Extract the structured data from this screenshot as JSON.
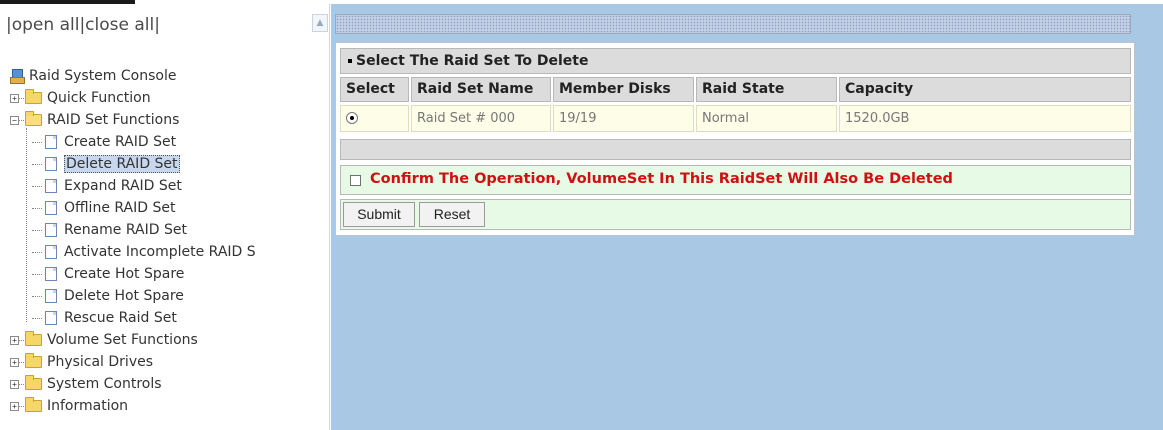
{
  "nav": {
    "open_all": "open all",
    "close_all": "close all",
    "separator_left": "|",
    "separator_mid": "|",
    "separator_right": "|"
  },
  "tree": {
    "root": "Raid System Console",
    "quick_function": "Quick Function",
    "raid_set_functions": "RAID Set Functions",
    "children": [
      "Create RAID Set",
      "Delete RAID Set",
      "Expand RAID Set",
      "Offline RAID Set",
      "Rename RAID Set",
      "Activate Incomplete RAID S",
      "Create Hot Spare",
      "Delete Hot Spare",
      "Rescue Raid Set"
    ],
    "volume_set_functions": "Volume Set Functions",
    "physical_drives": "Physical Drives",
    "system_controls": "System Controls",
    "information": "Information"
  },
  "panel": {
    "title": "Select The Raid Set To Delete",
    "headers": [
      "Select",
      "Raid Set Name",
      "Member Disks",
      "Raid State",
      "Capacity"
    ],
    "row": {
      "selected": true,
      "name": "Raid Set # 000",
      "member_disks": "19/19",
      "state": "Normal",
      "capacity": "1520.0GB"
    },
    "confirm_label": "Confirm The Operation, VolumeSet In This RaidSet Will Also Be Deleted",
    "submit_label": "Submit",
    "reset_label": "Reset"
  },
  "colors": {
    "content_bg": "#a9c8e3",
    "header_bg": "#dcdcdc",
    "row_bg": "#fdfde8",
    "confirm_bg": "#e6fae6",
    "warning_text": "#d01010",
    "selected_item_bg": "#c7d7ee"
  }
}
